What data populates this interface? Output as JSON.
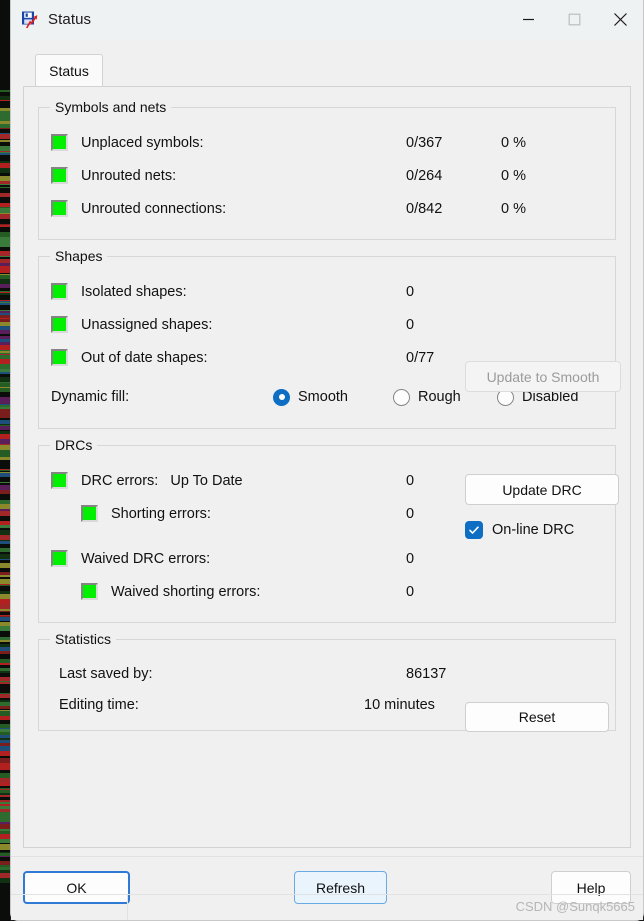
{
  "window": {
    "title": "Status",
    "icon": "pcb-editor-icon",
    "minimize_label": "Minimize",
    "maximize_label": "Maximize",
    "close_label": "Close"
  },
  "tabs": [
    {
      "label": "Status",
      "selected": true
    }
  ],
  "groups": {
    "symbols_and_nets": {
      "title": "Symbols and nets",
      "rows": [
        {
          "indicator": "green",
          "label": "Unplaced symbols:",
          "value": "0/367",
          "percent": "0 %"
        },
        {
          "indicator": "green",
          "label": "Unrouted nets:",
          "value": "0/264",
          "percent": "0 %"
        },
        {
          "indicator": "green",
          "label": "Unrouted connections:",
          "value": "0/842",
          "percent": "0 %"
        }
      ]
    },
    "shapes": {
      "title": "Shapes",
      "rows": [
        {
          "indicator": "green",
          "label": "Isolated shapes:",
          "value": "0"
        },
        {
          "indicator": "green",
          "label": "Unassigned shapes:",
          "value": "0"
        },
        {
          "indicator": "green",
          "label": "Out of date shapes:",
          "value": "0/77"
        }
      ],
      "update_to_smooth_label": "Update to Smooth",
      "update_to_smooth_enabled": false,
      "dynamic_fill_label": "Dynamic fill:",
      "dynamic_fill_options": [
        {
          "label": "Smooth",
          "selected": true
        },
        {
          "label": "Rough",
          "selected": false
        },
        {
          "label": "Disabled",
          "selected": false
        }
      ]
    },
    "drcs": {
      "title": "DRCs",
      "rows": [
        {
          "indicator": "green",
          "label": "DRC errors:",
          "status": "Up To Date",
          "value": "0",
          "indent": false
        },
        {
          "indicator": "green",
          "label": "Shorting errors:",
          "value": "0",
          "indent": true
        },
        {
          "indicator": "green",
          "label": "Waived DRC errors:",
          "value": "0",
          "indent": false
        },
        {
          "indicator": "green",
          "label": "Waived shorting errors:",
          "value": "0",
          "indent": true
        }
      ],
      "update_drc_label": "Update DRC",
      "online_drc_label": "On-line DRC",
      "online_drc_checked": true
    },
    "statistics": {
      "title": "Statistics",
      "rows": [
        {
          "label": "Last saved by:",
          "value": "86137"
        },
        {
          "label": "Editing time:",
          "value": "10 minutes"
        }
      ],
      "reset_label": "Reset"
    }
  },
  "footer": {
    "ok_label": "OK",
    "refresh_label": "Refresh",
    "help_label": "Help"
  },
  "watermark": "CSDN @Sunqk5665",
  "colors": {
    "indicator_green": "#00f000",
    "accent_blue": "#0d6ec4",
    "window_bg": "#f0f0f0",
    "titlebar_bg": "#eef2f3"
  }
}
